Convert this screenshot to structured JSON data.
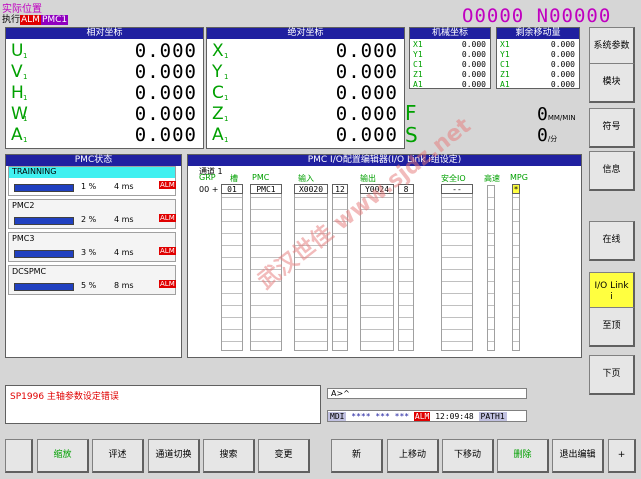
{
  "header": {
    "title": "实际位置",
    "mode": "执行",
    "alm": "ALM",
    "prog": "PMC1",
    "onum": "O0000 N00000"
  },
  "rel": {
    "title": "相对坐标",
    "axes": [
      {
        "name": "U",
        "sub": "1",
        "val": "0.000"
      },
      {
        "name": "V",
        "sub": "1",
        "val": "0.000"
      },
      {
        "name": "H",
        "sub": "1",
        "val": "0.000"
      },
      {
        "name": "W",
        "sub": "1",
        "val": "0.000"
      },
      {
        "name": "A",
        "sub": "1",
        "val": "0.000"
      }
    ]
  },
  "abs": {
    "title": "绝对坐标",
    "axes": [
      {
        "name": "X",
        "sub": "1",
        "val": "0.000"
      },
      {
        "name": "Y",
        "sub": "1",
        "val": "0.000"
      },
      {
        "name": "C",
        "sub": "1",
        "val": "0.000"
      },
      {
        "name": "Z",
        "sub": "1",
        "val": "0.000"
      },
      {
        "name": "A",
        "sub": "1",
        "val": "0.000"
      }
    ]
  },
  "mach": {
    "title": "机械坐标",
    "rows": [
      {
        "n": "X1",
        "v": "0.000"
      },
      {
        "n": "Y1",
        "v": "0.000"
      },
      {
        "n": "C1",
        "v": "0.000"
      },
      {
        "n": "Z1",
        "v": "0.000"
      },
      {
        "n": "A1",
        "v": "0.000"
      }
    ]
  },
  "dist": {
    "title": "剩余移动量",
    "rows": [
      {
        "n": "X1",
        "v": "0.000"
      },
      {
        "n": "Y1",
        "v": "0.000"
      },
      {
        "n": "C1",
        "v": "0.000"
      },
      {
        "n": "Z1",
        "v": "0.000"
      },
      {
        "n": "A1",
        "v": "0.000"
      }
    ]
  },
  "feed": {
    "f": "F",
    "s": "S",
    "f_val": "0",
    "f_unit": "MM/MIN",
    "s_val": "0",
    "s_unit": "/分"
  },
  "side": [
    "系统参数",
    "模块",
    "符号",
    "信息",
    "在线",
    "I/O Link i",
    "至顶",
    "下页"
  ],
  "pmc_status": {
    "title": "PMC状态",
    "items": [
      {
        "name": "TRAINNING",
        "pct": "1 %",
        "ms": "4 ms",
        "alm": "ALM"
      },
      {
        "name": "PMC2",
        "pct": "2 %",
        "ms": "4 ms",
        "alm": "ALM"
      },
      {
        "name": "PMC3",
        "pct": "3 %",
        "ms": "4 ms",
        "alm": "ALM"
      },
      {
        "name": "DCSPMC",
        "pct": "5 %",
        "ms": "8 ms",
        "alm": "ALM"
      }
    ]
  },
  "io": {
    "title": "PMC I/O配置编辑器(I/O Link i组设定)",
    "channel": "通道 1",
    "grp": "GRP",
    "slot": "槽",
    "pmc": "PMC",
    "input": "输入",
    "output": "输出",
    "safety": "安全IO",
    "high": "高速",
    "mpg": "MPG",
    "row": {
      "grp": "00",
      "mark": "+",
      "slot": "01",
      "pmc": "PMC1",
      "in": "X0020",
      "in_size": "12",
      "out": "Y0024",
      "out_size": "8",
      "safety": "--",
      "mpg": "*"
    }
  },
  "message": "SP1996 主轴参数设定错误",
  "input_line": "A>^",
  "status": {
    "mode": "MDI",
    "stars": "**** *** ***",
    "alm": "ALM",
    "time": "12:09:48",
    "path": "PATH1"
  },
  "softkeys": [
    "缩放",
    "评述",
    "通道切换",
    "搜索",
    "变更",
    "新",
    "上移动",
    "下移动",
    "删除",
    "退出编辑",
    "+"
  ],
  "watermark": "武汉世佳 www.sjdz.net",
  "colors": {
    "title_bar": "#2020a0",
    "axis": "#00a000",
    "onum": "#c000c0",
    "active_key": "#ffff40",
    "alarm": "#e00000"
  }
}
